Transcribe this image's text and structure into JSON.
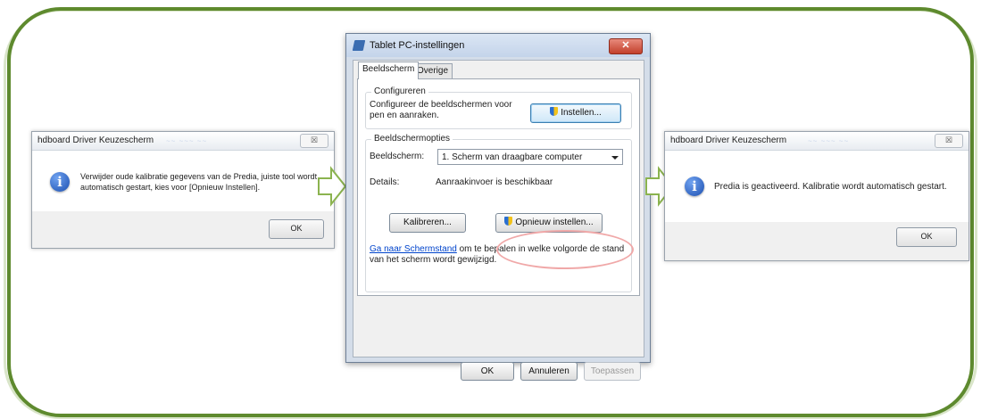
{
  "left_dialog": {
    "title": "hdboard Driver Keuzescherm",
    "close_label": "☒",
    "message": "Verwijder oude kalibratie gegevens van de Predia, juiste tool wordt automatisch gestart, kies voor [Opnieuw Instellen].",
    "ok_label": "OK"
  },
  "right_dialog": {
    "title": "hdboard Driver Keuzescherm",
    "close_label": "☒",
    "message": "Predia is geactiveerd. Kalibratie wordt automatisch gestart.",
    "ok_label": "OK"
  },
  "main_dialog": {
    "title": "Tablet PC-instellingen",
    "close_label": "✕",
    "tabs": [
      {
        "label": "Beeldscherm",
        "active": true
      },
      {
        "label": "Overige",
        "active": false
      }
    ],
    "configure": {
      "group_label": "Configureren",
      "text": "Configureer de beeldschermen voor pen en aanraken.",
      "button_label": "Instellen..."
    },
    "options": {
      "group_label": "Beeldschermopties",
      "display_label": "Beeldscherm:",
      "display_value": "1. Scherm van draagbare computer",
      "details_label": "Details:",
      "details_value": "Aanraakinvoer is beschikbaar",
      "calibrate_label": "Kalibreren...",
      "reset_label": "Opnieuw instellen..."
    },
    "link_text": "Ga naar Schermstand",
    "link_rest": " om te bepalen in welke volgorde de stand van het scherm wordt gewijzigd.",
    "footer": {
      "ok_label": "OK",
      "cancel_label": "Annuleren",
      "apply_label": "Toepassen"
    }
  },
  "colors": {
    "frame": "#5e8a2e",
    "arrow": "#8bb34f",
    "highlight": "#f0a8a8"
  }
}
